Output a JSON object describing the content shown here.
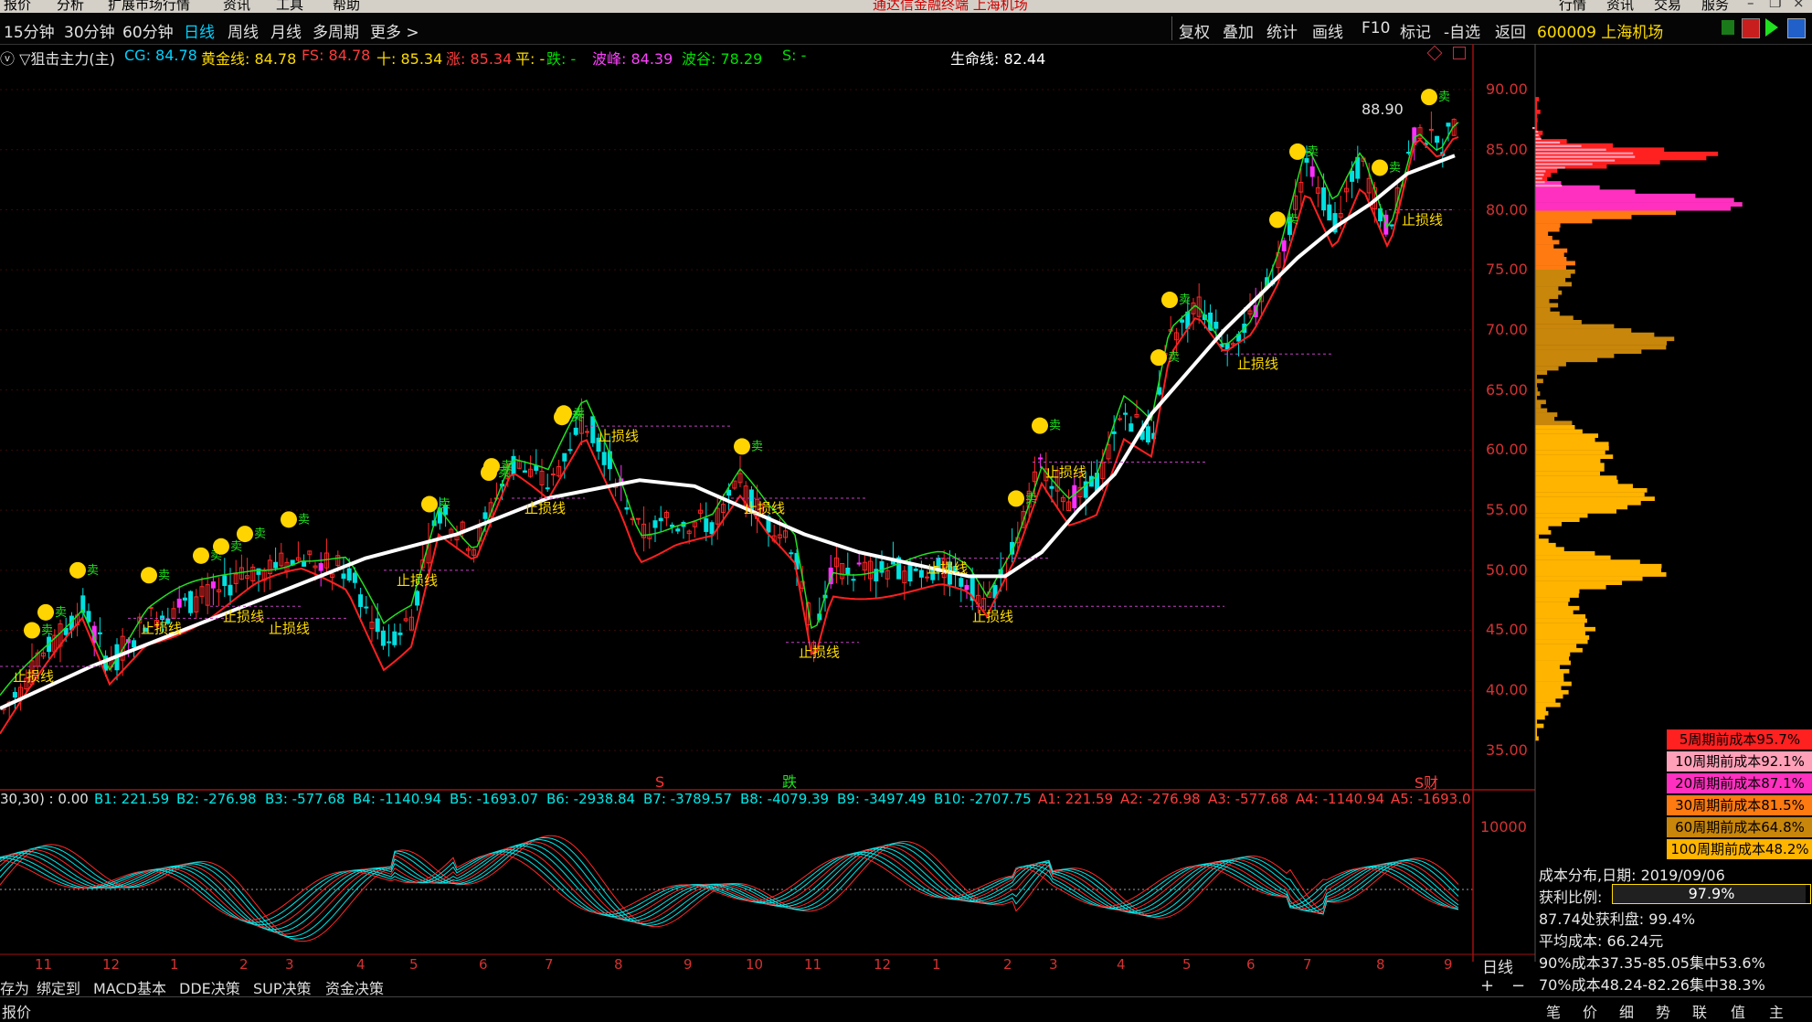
{
  "menu": {
    "items": [
      "报价",
      "分析",
      "扩展市场行情",
      "资讯",
      "工具",
      "帮助"
    ],
    "app_title": "通达信金融终端 上海机场",
    "right_items": [
      "行情",
      "资讯",
      "交易",
      "服务"
    ]
  },
  "toolbar": {
    "periods": [
      "15分钟",
      "30分钟",
      "60分钟",
      "日线",
      "周线",
      "月线",
      "多周期",
      "更多 >"
    ],
    "active_period": "日线",
    "right": [
      "复权",
      "叠加",
      "统计",
      "画线",
      "F10",
      "标记",
      "-自选",
      "返回"
    ],
    "stock": "600009 上海机场"
  },
  "indicator_row": [
    {
      "text": "ⓥ ▽狙击主力(主)",
      "color": "#e0e0e0"
    },
    {
      "text": "CG: 84.78",
      "color": "#00d2ff"
    },
    {
      "text": "黄金线: 84.78",
      "color": "#ffdc00"
    },
    {
      "text": "FS: 84.78",
      "color": "#ff3c3c"
    },
    {
      "text": "十: 85.34",
      "color": "#ffdc00"
    },
    {
      "text": "涨: 85.34",
      "color": "#ff3c3c"
    },
    {
      "text": "平: -",
      "color": "#ffdc00"
    },
    {
      "text": "跌: -",
      "color": "#00e000"
    },
    {
      "text": "波峰: 84.39",
      "color": "#ff40ff"
    },
    {
      "text": "波谷: 78.29",
      "color": "#00e000"
    },
    {
      "text": "S: -",
      "color": "#00e000"
    },
    {
      "text": "生命线: 82.44",
      "color": "#ffffff"
    }
  ],
  "sub_row": [
    {
      "text": "30,30) : 0.00",
      "color": "#e0e0e0"
    },
    {
      "text": "B1: 221.59",
      "color": "#00e8e8"
    },
    {
      "text": "B2: -276.98",
      "color": "#00e8e8"
    },
    {
      "text": "B3: -577.68",
      "color": "#00e8e8"
    },
    {
      "text": "B4: -1140.94",
      "color": "#00e8e8"
    },
    {
      "text": "B5: -1693.07",
      "color": "#00e8e8"
    },
    {
      "text": "B6: -2938.84",
      "color": "#00e8e8"
    },
    {
      "text": "B7: -3789.57",
      "color": "#00e8e8"
    },
    {
      "text": "B8: -4079.39",
      "color": "#00e8e8"
    },
    {
      "text": "B9: -3497.49",
      "color": "#00e8e8"
    },
    {
      "text": "B10: -2707.75",
      "color": "#00e8e8"
    },
    {
      "text": "A1: 221.59",
      "color": "#ff3c3c"
    },
    {
      "text": "A2: -276.98",
      "color": "#ff3c3c"
    },
    {
      "text": "A3: -577.68",
      "color": "#ff3c3c"
    },
    {
      "text": "A4: -1140.94",
      "color": "#ff3c3c"
    },
    {
      "text": "A5: -1693.0",
      "color": "#ff3c3c"
    }
  ],
  "price_axis": [
    "90.00",
    "85.00",
    "80.00",
    "75.00",
    "70.00",
    "65.00",
    "60.00",
    "55.00",
    "50.00",
    "45.00",
    "40.00",
    "35.00"
  ],
  "sub_axis_label": "10000",
  "high_label": "88.90",
  "month_labels": [
    "11",
    "12",
    "1",
    "2",
    "3",
    "4",
    "5",
    "6",
    "7",
    "8",
    "9",
    "10",
    "11",
    "12",
    "1",
    "2",
    "3",
    "4",
    "5",
    "6",
    "7",
    "8",
    "9"
  ],
  "period_label": "日线",
  "bottom_tabs": [
    "存为",
    "绑定到",
    "MACD基本",
    "DDE决策",
    "SUP决策",
    "资金决策"
  ],
  "status_left": "报价",
  "marks": {
    "s1": "S",
    "die": "跌",
    "cai": "S财"
  },
  "chips": {
    "cost_boxes": [
      {
        "text": "5周期前成本95.7%",
        "color": "#ff2020"
      },
      {
        "text": "10周期前成本92.1%",
        "color": "#ffa0b8"
      },
      {
        "text": "20周期前成本87.1%",
        "color": "#ff30c0"
      },
      {
        "text": "30周期前成本81.5%",
        "color": "#ff7a10"
      },
      {
        "text": "60周期前成本64.8%",
        "color": "#c8860a"
      },
      {
        "text": "100周期前成本48.2%",
        "color": "#ffb400"
      }
    ],
    "date_line": "成本分布,日期: 2019/09/06",
    "profit_label": "获利比例:",
    "profit_value": "97.9%",
    "profit_pct": 97.9,
    "lines": [
      "87.74处获利盘: 99.4%",
      "平均成本: 66.24元",
      "90%成本37.35-85.05集中53.6%",
      "70%成本48.24-82.26集中38.3%"
    ]
  },
  "right_bottom_tabs": [
    "笔",
    "价",
    "细",
    "势",
    "联",
    "值",
    "主"
  ],
  "plus_minus": [
    "+",
    "−"
  ]
}
